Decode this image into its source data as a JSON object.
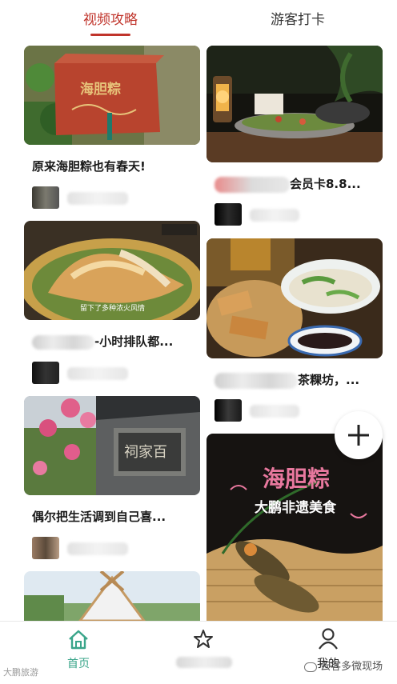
{
  "tabs": [
    {
      "label": "视频攻略",
      "active": true
    },
    {
      "label": "游客打卡",
      "active": false
    }
  ],
  "left_column": [
    {
      "title": "原来海胆粽也有春天!",
      "image_text": "海胆粽"
    },
    {
      "title": "-小时排队都...",
      "image_text": "留下了多种浓火风情"
    },
    {
      "title": "偶尔把生活调到自己喜...",
      "image_text": "祠家百"
    },
    {
      "title": "",
      "image_text": ""
    }
  ],
  "right_column": [
    {
      "title": "会员卡8.8...",
      "image_text": ""
    },
    {
      "title": "茶粿坊，...",
      "image_text": ""
    },
    {
      "title": "",
      "image_text": "海胆粽",
      "image_subtext": "大鹏非遗美食"
    }
  ],
  "fab": {
    "icon": "plus-icon"
  },
  "bottom_nav": [
    {
      "label": "首页",
      "icon": "home-icon",
      "active": true
    },
    {
      "label": "",
      "icon": "star-icon",
      "active": false
    },
    {
      "label": "我的",
      "icon": "person-icon",
      "active": false
    }
  ],
  "watermarks": {
    "left": "大鹏旅游",
    "right": "云客多微现场"
  },
  "colors": {
    "accent": "#c0342b",
    "nav_active": "#3aa58a",
    "text": "#1a1a1a"
  }
}
